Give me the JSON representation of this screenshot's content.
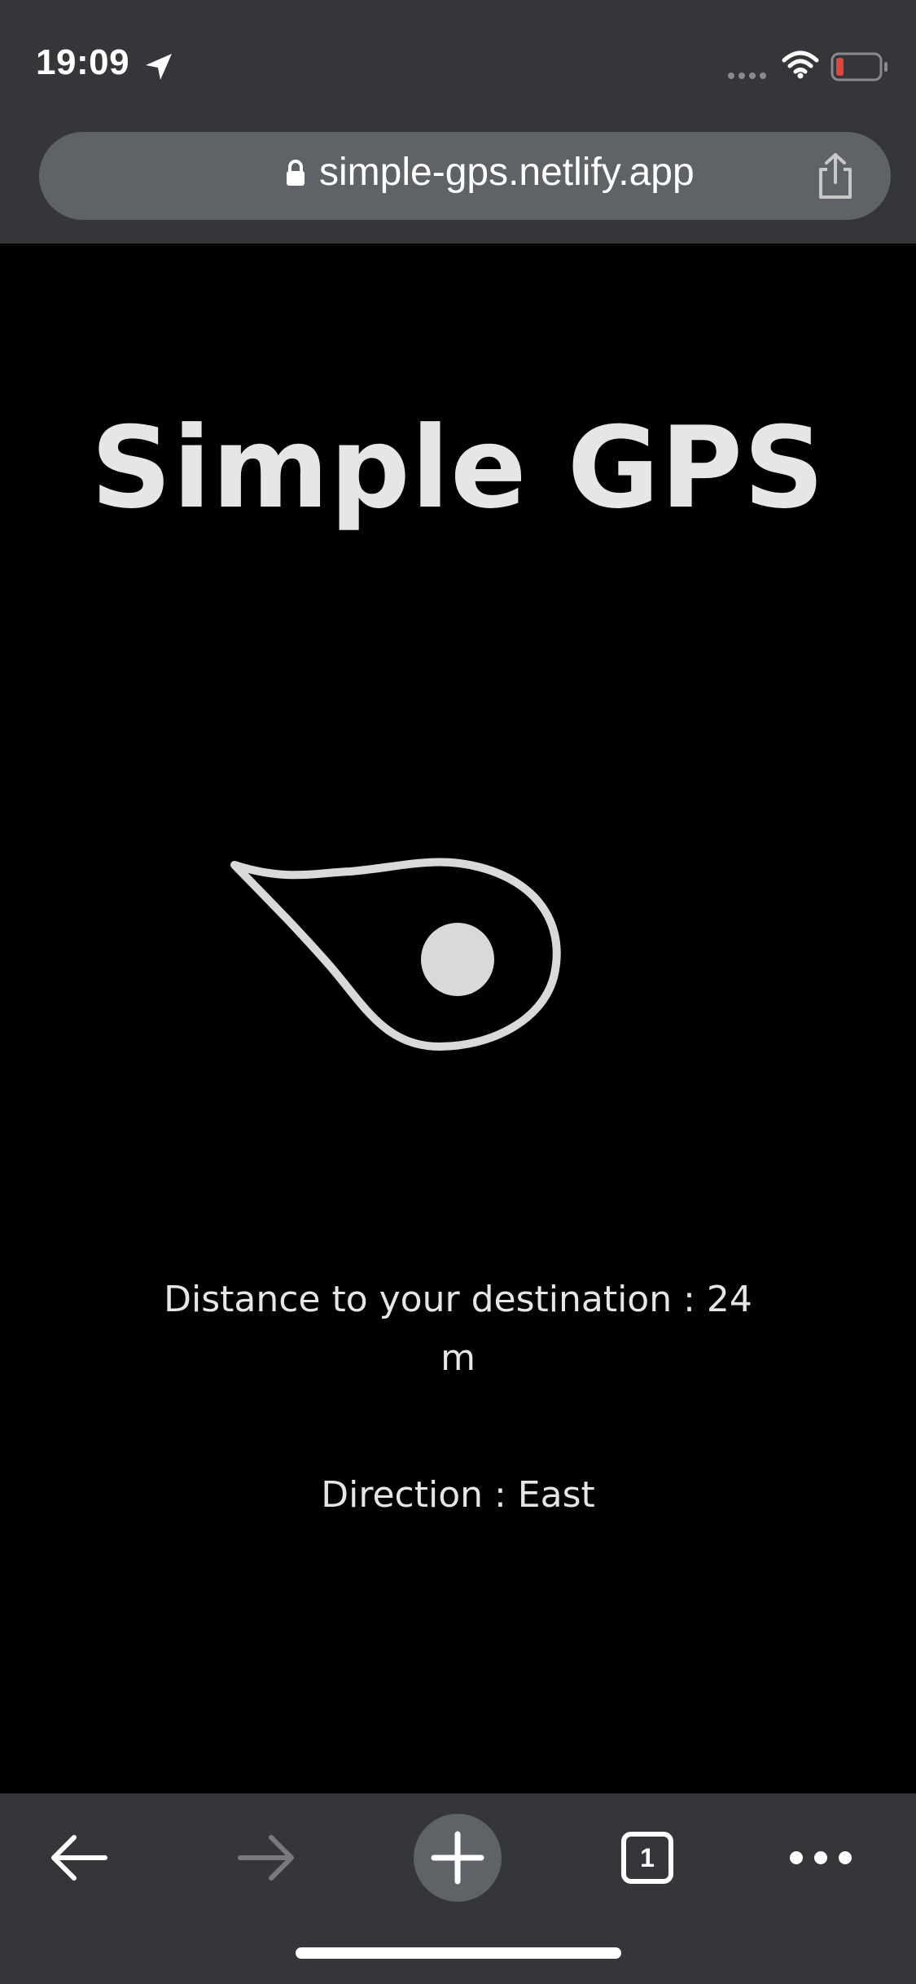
{
  "status_bar": {
    "time": "19:09",
    "icons": [
      "location-arrow-icon",
      "signal-icon",
      "wifi-icon",
      "battery-low-icon"
    ],
    "battery_color": "#e0443a"
  },
  "browser": {
    "url": "simple-gps.netlify.app",
    "icons": [
      "lock-icon",
      "share-icon"
    ],
    "open_tab_count": "1",
    "toolbar_icons": [
      "back-arrow-icon",
      "forward-arrow-icon",
      "plus-icon",
      "tabs-icon",
      "more-icon"
    ]
  },
  "page": {
    "title": "Simple GPS",
    "distance_text": "Distance to your destination : 24 m",
    "direction_text": "Direction : East",
    "compass_icon": "direction-pointer-icon"
  },
  "colors": {
    "chrome_bg": "#35363a",
    "url_bar_bg": "#5f6368",
    "page_bg": "#000000",
    "text": "#e6e6e6",
    "icon": "#d9d9d9"
  }
}
